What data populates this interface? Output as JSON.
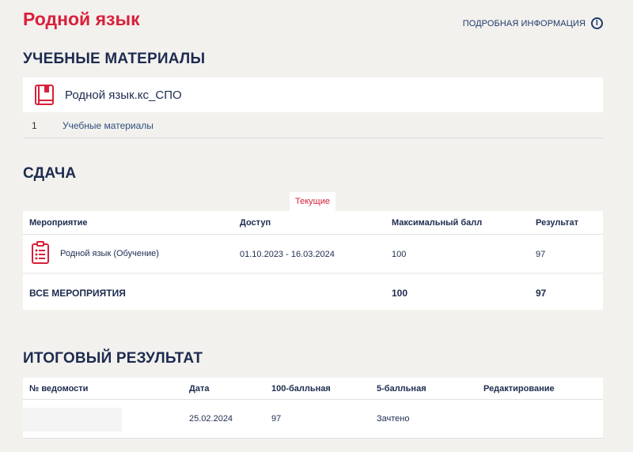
{
  "page": {
    "title": "Родной язык",
    "more_info": "ПОДРОБНАЯ ИНФОРМАЦИЯ",
    "info_icon": "info-icon"
  },
  "materials": {
    "section_title": "УЧЕБНЫЕ МАТЕРИАЛЫ",
    "course_name": "Родной язык.кс_СПО",
    "icon": "book-icon",
    "items": [
      {
        "num": "1",
        "label": "Учебные материалы"
      }
    ]
  },
  "submission": {
    "section_title": "СДАЧА",
    "tab": "Текущие",
    "headers": [
      "Мероприятие",
      "Доступ",
      "Максимальный балл",
      "Результат"
    ],
    "rows": [
      {
        "event": "Родной язык (Обучение)",
        "access": "01.10.2023 - 16.03.2024",
        "max": "100",
        "result": "97",
        "icon": "clipboard-icon"
      }
    ],
    "total": {
      "label": "ВСЕ МЕРОПРИЯТИЯ",
      "max": "100",
      "result": "97"
    }
  },
  "final": {
    "section_title": "ИТОГОВЫЙ РЕЗУЛЬТАТ",
    "headers": [
      "№ ведомости",
      "Дата",
      "100-балльная",
      "5-балльная",
      "Редактирование"
    ],
    "rows": [
      {
        "number": "",
        "date": "25.02.2024",
        "score100": "97",
        "score5": "Зачтено",
        "edit": ""
      }
    ]
  },
  "colors": {
    "accent": "#d8203a",
    "text": "#1d2b4f",
    "background": "#f3f1ee"
  }
}
